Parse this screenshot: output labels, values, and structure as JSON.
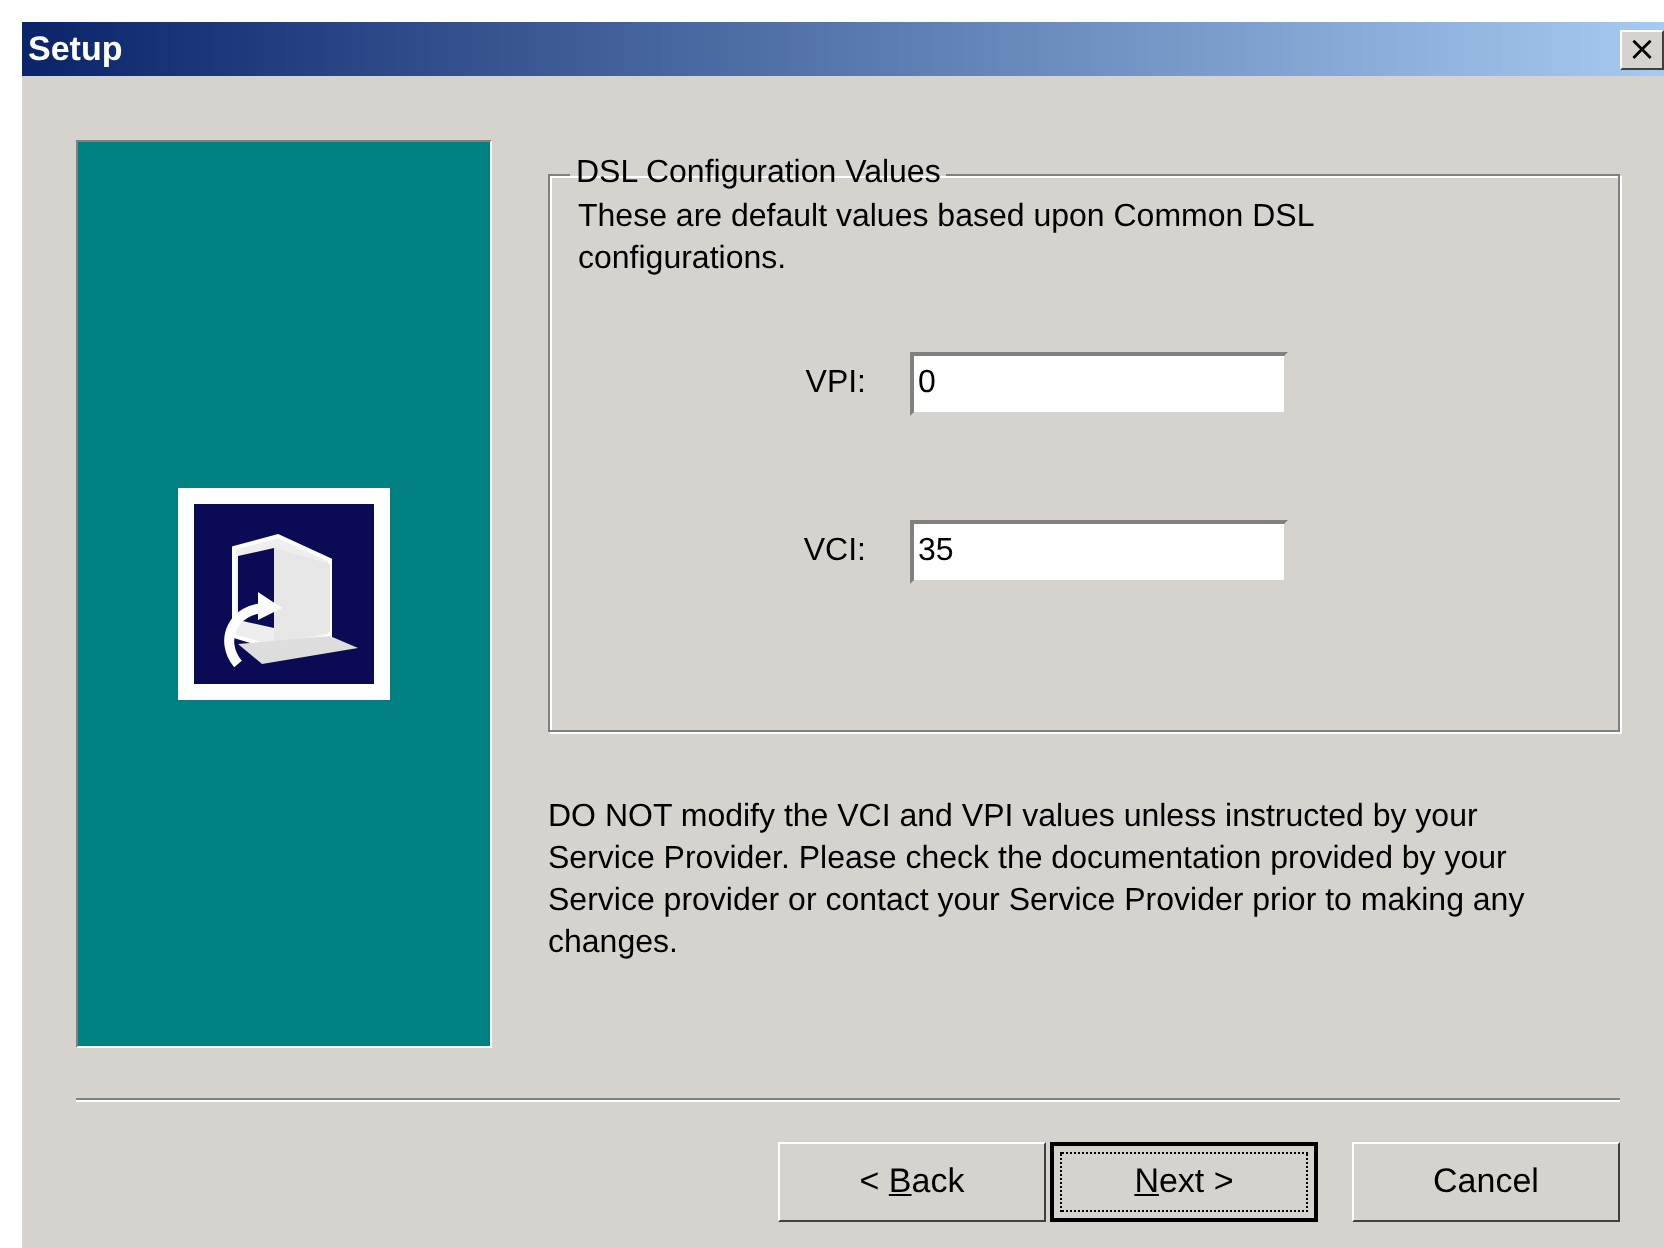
{
  "window": {
    "title": "Setup",
    "close": "×"
  },
  "group": {
    "title": "DSL Configuration Values",
    "description": "These are default values based upon Common DSL configurations.",
    "fields": [
      {
        "label": "VPI:",
        "value": "0"
      },
      {
        "label": "VCI:",
        "value": "35"
      }
    ]
  },
  "note": "DO NOT modify the VCI and VPI values unless instructed by your Service Provider.  Please check the documentation provided by your Service provider or contact your Service Provider prior to making any changes.",
  "buttons": [
    {
      "before": "< ",
      "key": "B",
      "after": "ack",
      "default": false
    },
    {
      "key": "N",
      "after": "ext >",
      "default": true
    },
    {
      "before": "Cancel",
      "default": false
    }
  ]
}
